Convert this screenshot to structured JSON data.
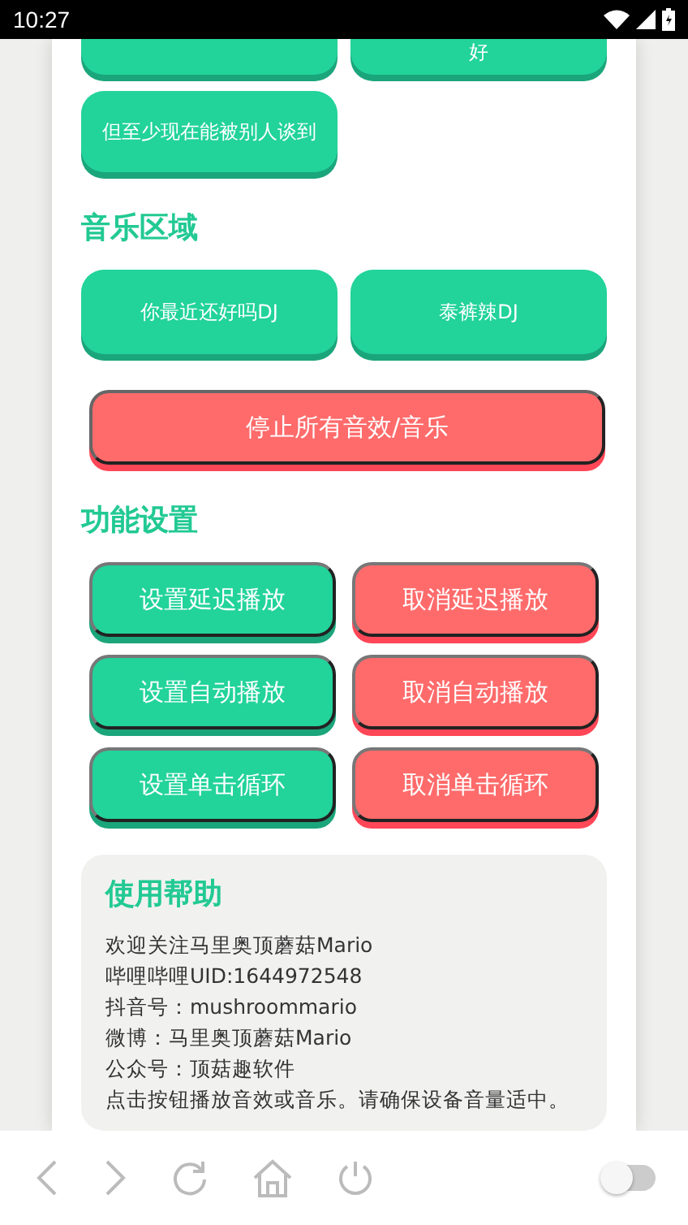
{
  "status_bar": {
    "time": "10:27"
  },
  "sound_buttons": [
    {
      "label": "好"
    },
    {
      "label": "但至少现在能被别人谈到"
    }
  ],
  "music_section": {
    "title": "音乐区域",
    "buttons": [
      {
        "label": "你最近还好吗DJ"
      },
      {
        "label": "泰裤辣DJ"
      }
    ]
  },
  "stop_button": {
    "label": "停止所有音效/音乐"
  },
  "settings_section": {
    "title": "功能设置",
    "buttons": [
      {
        "label": "设置延迟播放",
        "kind": "set"
      },
      {
        "label": "取消延迟播放",
        "kind": "cancel"
      },
      {
        "label": "设置自动播放",
        "kind": "set"
      },
      {
        "label": "取消自动播放",
        "kind": "cancel"
      },
      {
        "label": "设置单击循环",
        "kind": "set"
      },
      {
        "label": "取消单击循环",
        "kind": "cancel"
      }
    ]
  },
  "help": {
    "title": "使用帮助",
    "lines": [
      "欢迎关注马里奥顶蘑菇Mario",
      "哔哩哔哩UID:1644972548",
      "抖音号：mushroommario",
      "微博：马里奥顶蘑菇Mario",
      "公众号：顶菇趣软件",
      "点击按钮播放音效或音乐。请确保设备音量适中。"
    ]
  },
  "browser_bar": {
    "toggle": {
      "on": false
    }
  }
}
